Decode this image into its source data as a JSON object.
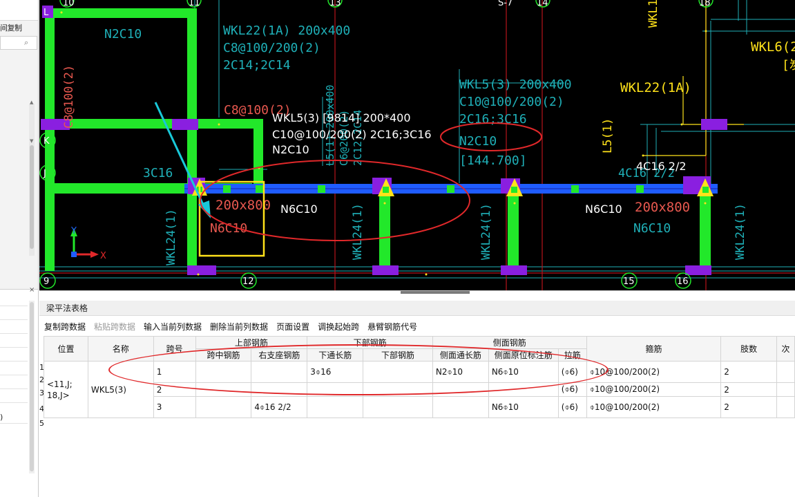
{
  "left_panel": {
    "copy_label": "间复制",
    "search_icon": "search-icon",
    "close_icon": "×",
    "item_paren": ")"
  },
  "cad": {
    "axis_labels_top": [
      "10",
      "11",
      "13",
      "S-7",
      "14",
      "18"
    ],
    "axis_labels_left": [
      "L",
      "K",
      "J",
      "9"
    ],
    "axis_labels_bottom": [
      "12",
      "15",
      "16"
    ],
    "texts": {
      "wkl22_a": "WKL22(1A) 200x400",
      "wkl22_b": "C8@100/200(2)",
      "wkl22_c": "2C14;2C14",
      "n2c10_top": "N2C10",
      "c8_vertical": "C8@100(2)",
      "c8_horizontal": "C8@100(2)",
      "wkl5_a": "WKL5(3) 200x400",
      "wkl5_b": "C10@100/200(2)",
      "wkl5_c": "2C16;3C16",
      "wkl5_d": "N2C10",
      "wkl5_e": "[144.700]",
      "wkl6": "WKL6(2",
      "wkl6_b": "[炭",
      "wkl22_right": "WKL22(1A)",
      "l5": "L5(1)",
      "wkl1_vert": "WKL1",
      "c3c16": "3C16",
      "popup_a": "WKL5(3) [9814] 200*400",
      "popup_b": "C10@100/200(2) 2C16;3C16",
      "popup_c": "N2C10",
      "size_a": "200x800",
      "size_a_n": "N6C10",
      "label_n6c10_a": "N6C10",
      "label_n6c10_b": "N6C10",
      "size_b": "200x800",
      "size_b_n": "N6C10",
      "c4c16": "4C16 2/2",
      "c4c16_dim": "4C16 2/2",
      "wkl24": "WKL24(1)",
      "l5_mid": "L5(1) 200x400",
      "l5_mid_b": "C6@200(2)",
      "l5_mid_c": "2C12;2C14",
      "ucs_y": "Y",
      "ucs_x": "X"
    }
  },
  "beam_panel": {
    "title": "梁平法表格",
    "toolbar": {
      "copy_span": "复制跨数据",
      "paste_span": "粘贴跨数据",
      "input_col": "输入当前列数据",
      "delete_col": "删除当前列数据",
      "page_setup": "页面设置",
      "swap_start": "调换起始跨",
      "cantilever": "悬臂钢筋代号"
    },
    "headers": {
      "position": "位置",
      "name": "名称",
      "span": "跨号",
      "top_rebar": "上部钢筋",
      "mid_span": "跨中钢筋",
      "right_support": "右支座钢筋",
      "bottom_rebar": "下部钢筋",
      "bottom_through": "下通长筋",
      "bottom_bars": "下部钢筋",
      "side_rebar": "侧面钢筋",
      "side_through": "侧面通长筋",
      "side_orig": "侧面原位标注筋",
      "tie": "拉筋",
      "stirrup": "箍筋",
      "legs": "肢数",
      "next": "次"
    },
    "row_numbers": [
      "1",
      "2",
      "3",
      "4",
      "5"
    ],
    "position": "<11,J;\n18,J>",
    "name": "WKL5(3)",
    "rows": [
      {
        "span": "1",
        "mid": "",
        "right": "",
        "bottom_through": "3⌽16",
        "bottom": "",
        "side_through": "N2⌽10",
        "side_orig": "N6⌽10",
        "tie": "(⌽6)",
        "stirrup": "⌽10@100/200(2)",
        "legs": "2"
      },
      {
        "span": "2",
        "mid": "",
        "right": "",
        "bottom_through": "",
        "bottom": "",
        "side_through": "",
        "side_orig": "",
        "tie": "(⌽6)",
        "stirrup": "⌽10@100/200(2)",
        "legs": "2"
      },
      {
        "span": "3",
        "mid": "",
        "right": "4⌽16 2/2",
        "bottom_through": "",
        "bottom": "",
        "side_through": "",
        "side_orig": "N6⌽10",
        "tie": "(⌽6)",
        "stirrup": "⌽10@100/200(2)",
        "legs": "2"
      }
    ]
  },
  "colors": {
    "beam_green": "#22e82a",
    "beam_blue": "#1f5cff",
    "column_purple": "#8a1fe0",
    "cad_cyan": "#1fb0b8",
    "cad_red_line": "#b8141c",
    "annotation_red": "#e0282a",
    "annotation_yellow": "#ffe21a",
    "highlight_cyan": "#19c8d8"
  }
}
